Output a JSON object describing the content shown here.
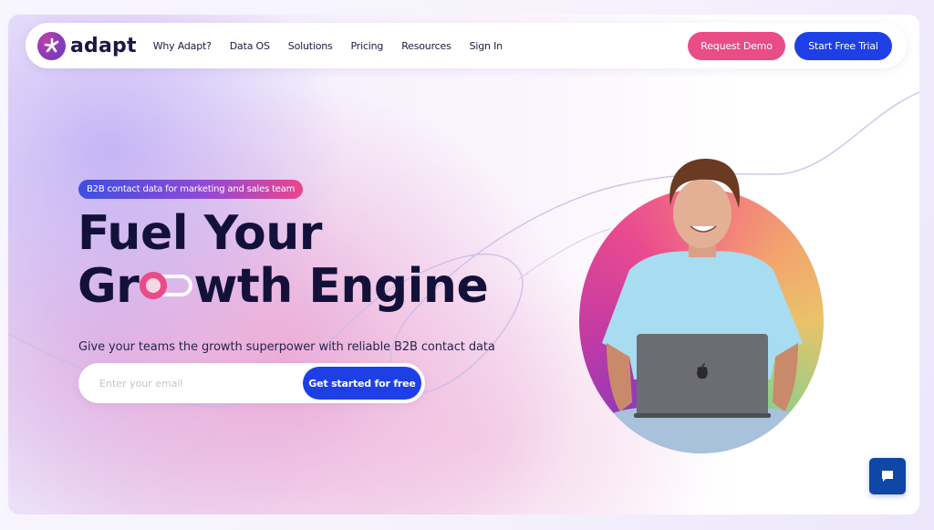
{
  "brand": {
    "name": "adapt",
    "logo_icon": "adapt-asterisk-logo-icon"
  },
  "nav": {
    "links": [
      "Why Adapt?",
      "Data OS",
      "Solutions",
      "Pricing",
      "Resources",
      "Sign In"
    ],
    "request_demo_label": "Request Demo",
    "start_trial_label": "Start Free Trial"
  },
  "hero": {
    "badge": "B2B contact data for marketing and sales team",
    "headline_line1": "Fuel Your",
    "headline_line2_prefix": "Gr",
    "headline_line2_suffix": "wth Engine",
    "headline_toggle_icon": "toggle-switch-icon",
    "subtitle": "Give your teams the growth superpower with reliable B2B contact data",
    "email_placeholder": "Enter your email",
    "email_value": "",
    "cta_label": "Get started for free",
    "image_alt": "Smiling man in light blue t-shirt using a laptop"
  },
  "chat": {
    "icon": "chat-bubble-icon",
    "label": "Open chat"
  },
  "colors": {
    "primary_blue": "#1f3fe6",
    "pink": "#e94c86",
    "navy_text": "#13113a",
    "chat_blue": "#0e47a6"
  }
}
